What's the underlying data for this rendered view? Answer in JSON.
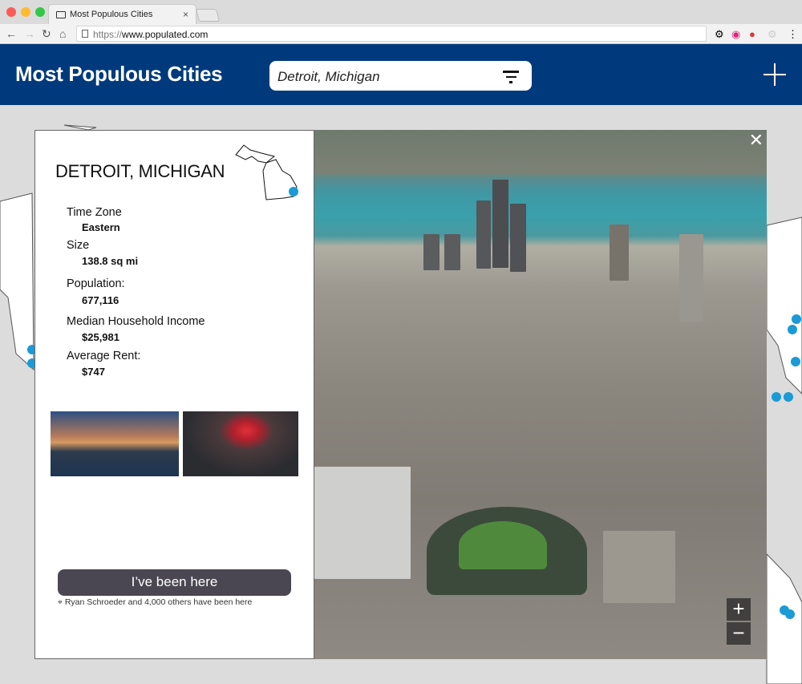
{
  "browser": {
    "tab_title": "Most Populous Cities",
    "url_protocol": "https://",
    "url_host": "www.populated.com"
  },
  "header": {
    "title": "Most Populous Cities",
    "search_value": "Detroit, Michigan"
  },
  "city": {
    "name": "DETROIT, MICHIGAN",
    "fields": [
      {
        "label": "Time Zone",
        "value": "Eastern"
      },
      {
        "label": "Size",
        "value": "138.8 sq mi"
      },
      {
        "label": "Population:",
        "value": "677,116"
      },
      {
        "label": "Median Household Income",
        "value": "$25,981"
      },
      {
        "label": "Average Rent:",
        "value": "$747"
      }
    ]
  },
  "actions": {
    "been_here": "I’ve been here",
    "been_here_note": "Ryan Schroeder and 4,000 others have been here"
  },
  "map_controls": {
    "zoom_in": "+",
    "zoom_out": "−",
    "close": "✕"
  },
  "colors": {
    "brand": "#003a7c",
    "marker": "#1a9ad6",
    "button": "#4a4752"
  }
}
